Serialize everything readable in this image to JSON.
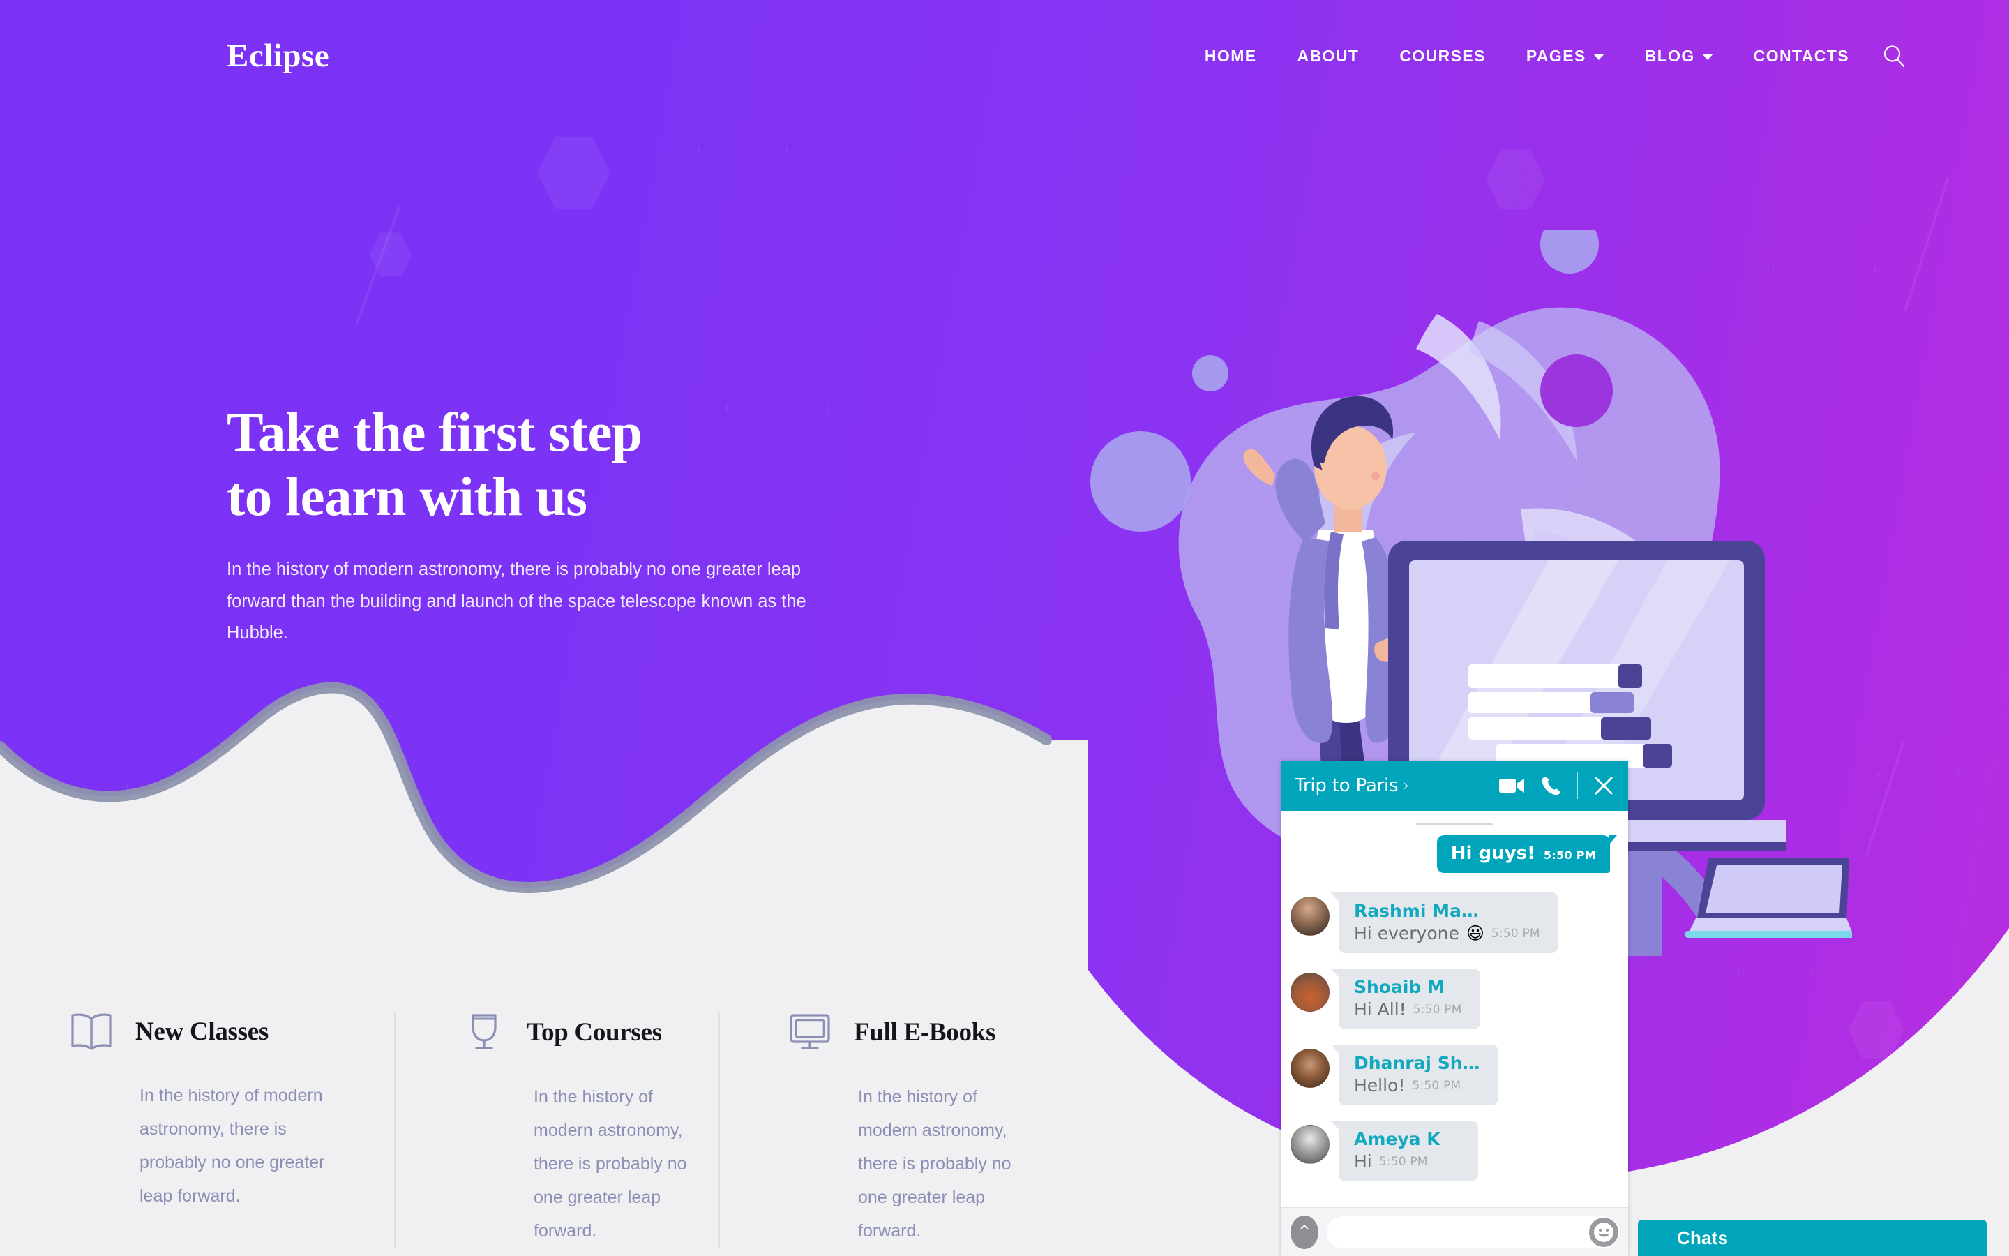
{
  "brand": {
    "name": "Eclipse"
  },
  "nav": {
    "items": [
      {
        "label": "HOME",
        "icon": "",
        "has_caret": false
      },
      {
        "label": "ABOUT",
        "icon": "",
        "has_caret": false
      },
      {
        "label": "COURSES",
        "icon": "",
        "has_caret": false
      },
      {
        "label": "PAGES",
        "icon": "chevron-down-icon",
        "has_caret": true
      },
      {
        "label": "BLOG",
        "icon": "chevron-down-icon",
        "has_caret": true
      },
      {
        "label": "CONTACTS",
        "icon": "",
        "has_caret": false
      }
    ],
    "search_icon": "search-icon"
  },
  "hero": {
    "title_line1": "Take the first step",
    "title_line2": "to learn with us",
    "subtitle": "In the history of modern astronomy, there is probably no one greater leap forward than the building and launch of the space telescope known as the Hubble."
  },
  "features": [
    {
      "icon": "open-book-icon",
      "title": "New Classes",
      "body": "In the history of modern astronomy, there is probably no one greater leap forward."
    },
    {
      "icon": "trophy-icon",
      "title": "Top Courses",
      "body": "In the history of modern astronomy, there is probably no one greater leap forward."
    },
    {
      "icon": "monitor-icon",
      "title": "Full E-Books",
      "body": "In the history of modern astronomy, there is probably no one greater leap forward."
    }
  ],
  "chat": {
    "title": "Trip to Paris",
    "chevron": "›",
    "actions": [
      {
        "name": "video-call-icon"
      },
      {
        "name": "phone-call-icon"
      },
      {
        "name": "close-icon"
      }
    ],
    "outgoing": {
      "text": "Hi guys!",
      "time": "5:50 PM"
    },
    "messages": [
      {
        "sender": "Rashmi Ma…",
        "text": "Hi everyone",
        "emoji": "😃",
        "time": "5:50 PM",
        "avatar_tint": "#5d4a42"
      },
      {
        "sender": "Shoaib M",
        "text": "Hi All!",
        "emoji": "",
        "time": "5:50 PM",
        "avatar_tint": "#b5572c"
      },
      {
        "sender": "Dhanraj Sh…",
        "text": "Hello!",
        "emoji": "",
        "time": "5:50 PM",
        "avatar_tint": "#7d4a2b"
      },
      {
        "sender": "Ameya K",
        "text": "Hi",
        "emoji": "",
        "time": "5:50 PM",
        "avatar_tint": "#8a8a8a"
      }
    ],
    "input_placeholder": "",
    "input_value": "",
    "scroll_up_icon": "chevron-up-icon",
    "emoji_icon": "emoji-smiley-icon"
  },
  "chats_bar": {
    "label": "Chats"
  },
  "colors": {
    "purple_left": "#7c32f5",
    "purple_right": "#b92de0",
    "page_bg": "#f0f0f2",
    "teal": "#00a5bb",
    "sender_teal": "#12a9bf",
    "muted_text": "#8b8fb5",
    "wave_shadow": "#8e93ae"
  }
}
